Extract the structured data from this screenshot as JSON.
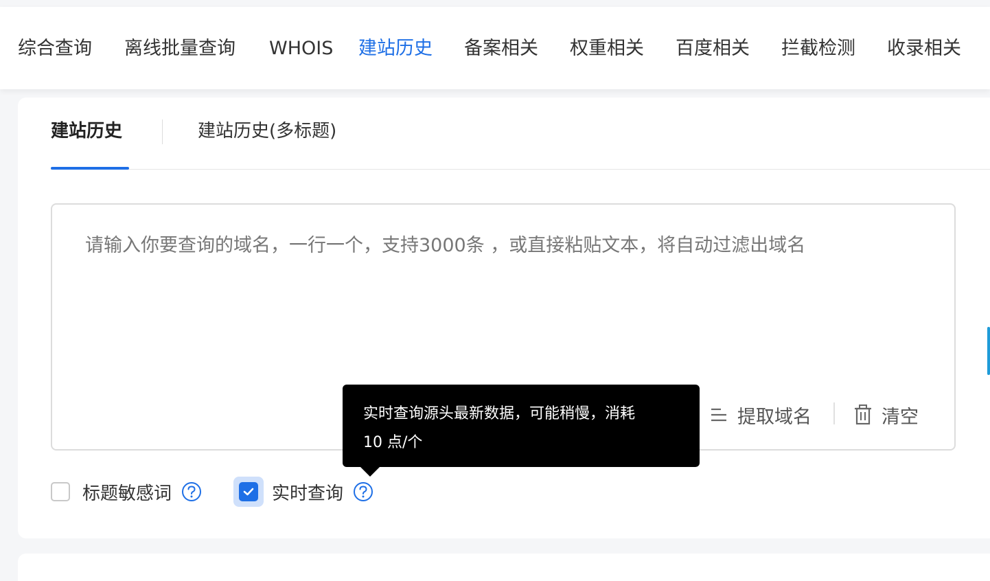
{
  "topnav": {
    "items": [
      {
        "label": "综合查询",
        "active": false
      },
      {
        "label": "离线批量查询",
        "active": false
      },
      {
        "label": "WHOIS",
        "active": false
      },
      {
        "label": "建站历史",
        "active": true
      },
      {
        "label": "备案相关",
        "active": false
      },
      {
        "label": "权重相关",
        "active": false
      },
      {
        "label": "百度相关",
        "active": false
      },
      {
        "label": "拦截检测",
        "active": false
      },
      {
        "label": "收录相关",
        "active": false
      }
    ]
  },
  "subtabs": {
    "items": [
      {
        "label": "建站历史",
        "active": true
      },
      {
        "label": "建站历史(多标题)",
        "active": false
      }
    ]
  },
  "input": {
    "value": "",
    "placeholder": "请输入你要查询的域名，一行一个，支持3000条 ，或直接粘贴文本，将自动过滤出域名"
  },
  "actions": {
    "extract_label": "提取域名",
    "clear_label": "清空"
  },
  "options": {
    "sensitive": {
      "label": "标题敏感词",
      "checked": false
    },
    "realtime": {
      "label": "实时查询",
      "checked": true
    }
  },
  "tooltip": {
    "line1": "实时查询源头最新数据，可能稍慢，消耗",
    "line2": "10 点/个"
  },
  "colors": {
    "accent": "#1e6fe6",
    "text": "#333333",
    "placeholder": "#777777"
  }
}
